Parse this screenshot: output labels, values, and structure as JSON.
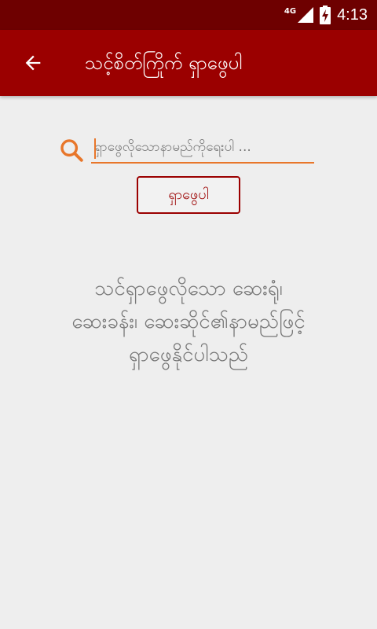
{
  "status_bar": {
    "network": "4G",
    "time": "4:13",
    "icons": [
      "signal-icon",
      "battery-charging-icon"
    ]
  },
  "app_bar": {
    "title": "သင့်စိတ်ကြိုက် ရှာဖွေပါ",
    "back_icon": "arrow-back-icon"
  },
  "search": {
    "placeholder": "ရှာဖွေလိုသောနာမည်ကိုရေးပါ ...",
    "value": "",
    "button_label": "ရှာဖွေပါ",
    "icon": "search-icon",
    "accent_color": "#e8762a"
  },
  "message": {
    "line1": "သင်ရှာဖွေလိုသော ဆေးရုံ၊",
    "line2": "ဆေးခန်း၊ ဆေးဆိုင်၏နာမည်ဖြင့်",
    "line3": "ရှာဖွေနိုင်ပါသည်"
  },
  "colors": {
    "app_bar": "#9b0000",
    "status_bar": "#6e0000",
    "background": "#eeeeee"
  }
}
